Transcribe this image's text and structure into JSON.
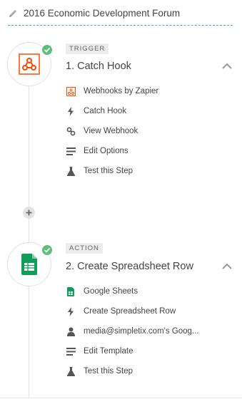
{
  "zap": {
    "title": "2016 Economic Development Forum"
  },
  "steps": [
    {
      "badge": "TRIGGER",
      "title": "1. Catch Hook",
      "app_icon": "webhook-icon",
      "items": [
        {
          "label": "Webhooks by Zapier",
          "icon": "webhook-small-icon"
        },
        {
          "label": "Catch Hook",
          "icon": "bolt-icon"
        },
        {
          "label": "View Webhook",
          "icon": "link-icon"
        },
        {
          "label": "Edit Options",
          "icon": "lines-icon"
        },
        {
          "label": "Test this Step",
          "icon": "flask-icon"
        }
      ]
    },
    {
      "badge": "ACTION",
      "title": "2. Create Spreadsheet Row",
      "app_icon": "google-sheets-icon",
      "items": [
        {
          "label": "Google Sheets",
          "icon": "sheets-small-icon"
        },
        {
          "label": "Create Spreadsheet Row",
          "icon": "bolt-icon"
        },
        {
          "label": "media@simpletix.com's Goog...",
          "icon": "user-icon"
        },
        {
          "label": "Edit Template",
          "icon": "lines-icon"
        },
        {
          "label": "Test this Step",
          "icon": "flask-icon"
        }
      ]
    }
  ],
  "colors": {
    "check": "#5dbf7c",
    "webhook": "#ff4a00",
    "sheets": "#0f9d58",
    "divider": "#4aa3df"
  }
}
